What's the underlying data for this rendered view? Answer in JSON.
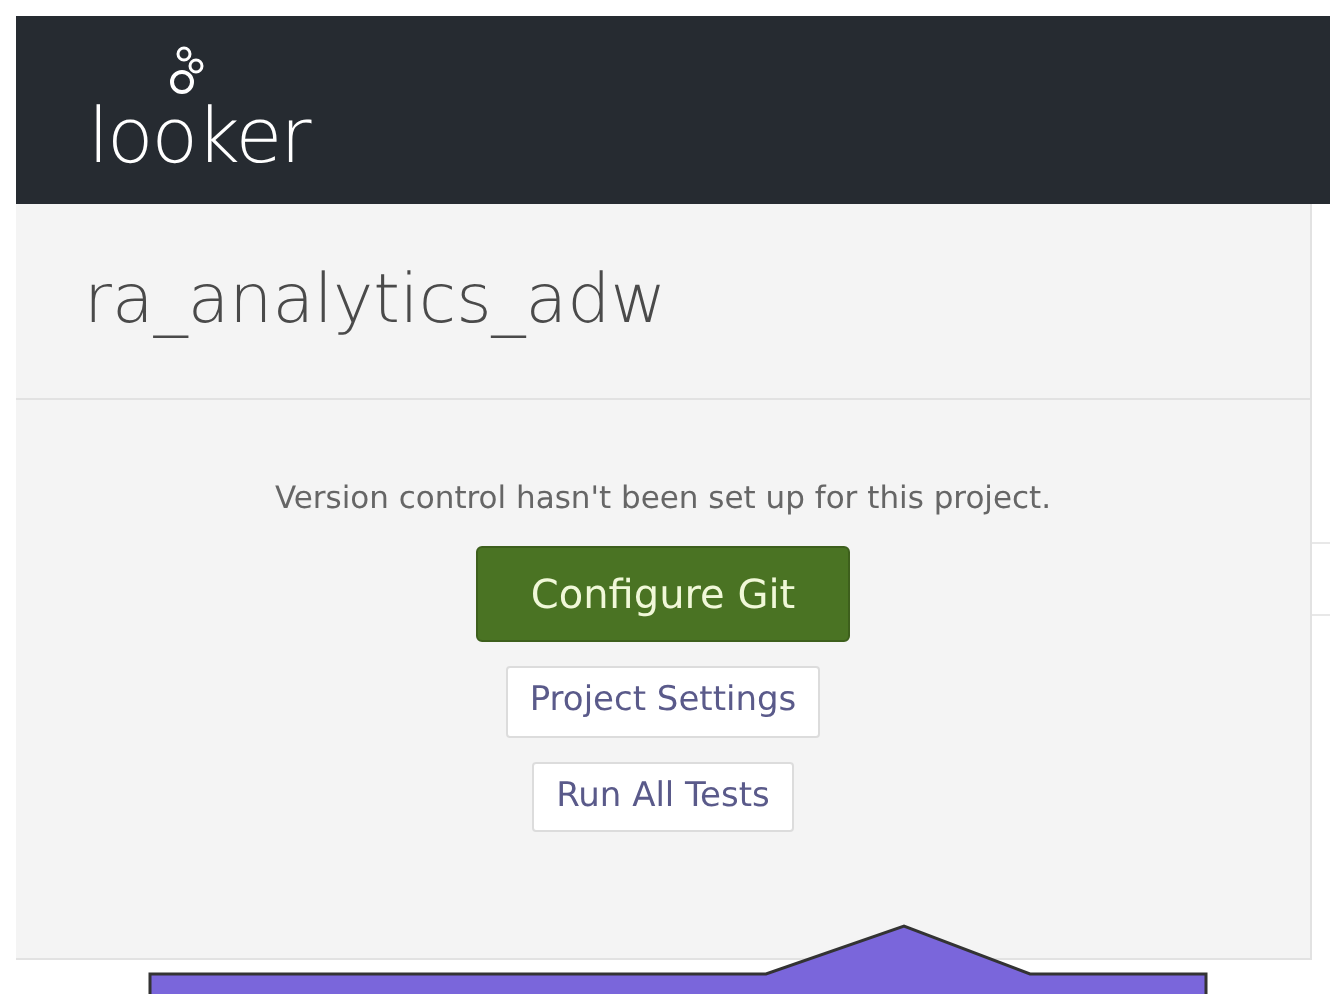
{
  "header": {
    "logo": "looker"
  },
  "project": {
    "title": "ra_analytics_adw"
  },
  "git_panel": {
    "message": "Version control hasn't been set up for this project.",
    "buttons": [
      {
        "label": "Configure Git",
        "kind": "primary"
      },
      {
        "label": "Project Settings",
        "kind": "secondary"
      },
      {
        "label": "Run All Tests",
        "kind": "secondary"
      }
    ]
  },
  "callout": {
    "kind": "tooltip"
  }
}
